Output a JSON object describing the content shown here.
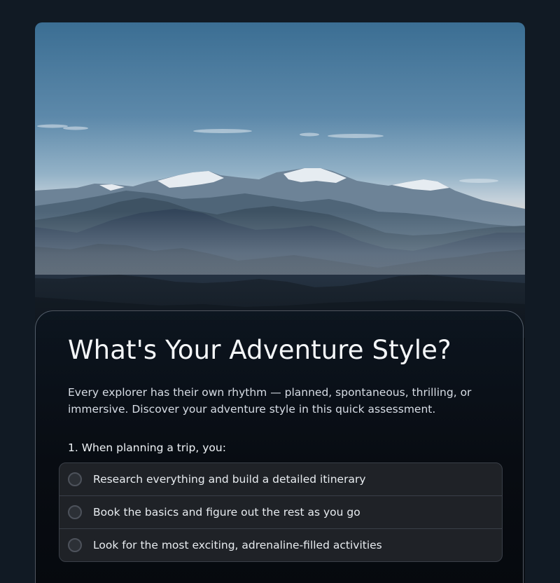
{
  "hero": {
    "image": "mountain-range-photo"
  },
  "quiz": {
    "title": "What's Your Adventure Style?",
    "intro": "Every explorer has their own rhythm — planned, spontaneous, thrilling, or immersive. Discover your adventure style in this quick assessment.",
    "question": "1. When planning a trip, you:",
    "options": [
      {
        "label": "Research everything and build a detailed itinerary",
        "selected": false
      },
      {
        "label": "Book the basics and figure out the rest as you go",
        "selected": false
      },
      {
        "label": "Look for the most exciting, adrenaline-filled activities",
        "selected": false
      }
    ]
  },
  "colors": {
    "page_background": "#111a24",
    "panel_background": "#080c12",
    "option_background": "#1f2227",
    "option_border": "#3a3f48",
    "title_text": "#f4f6f8"
  }
}
